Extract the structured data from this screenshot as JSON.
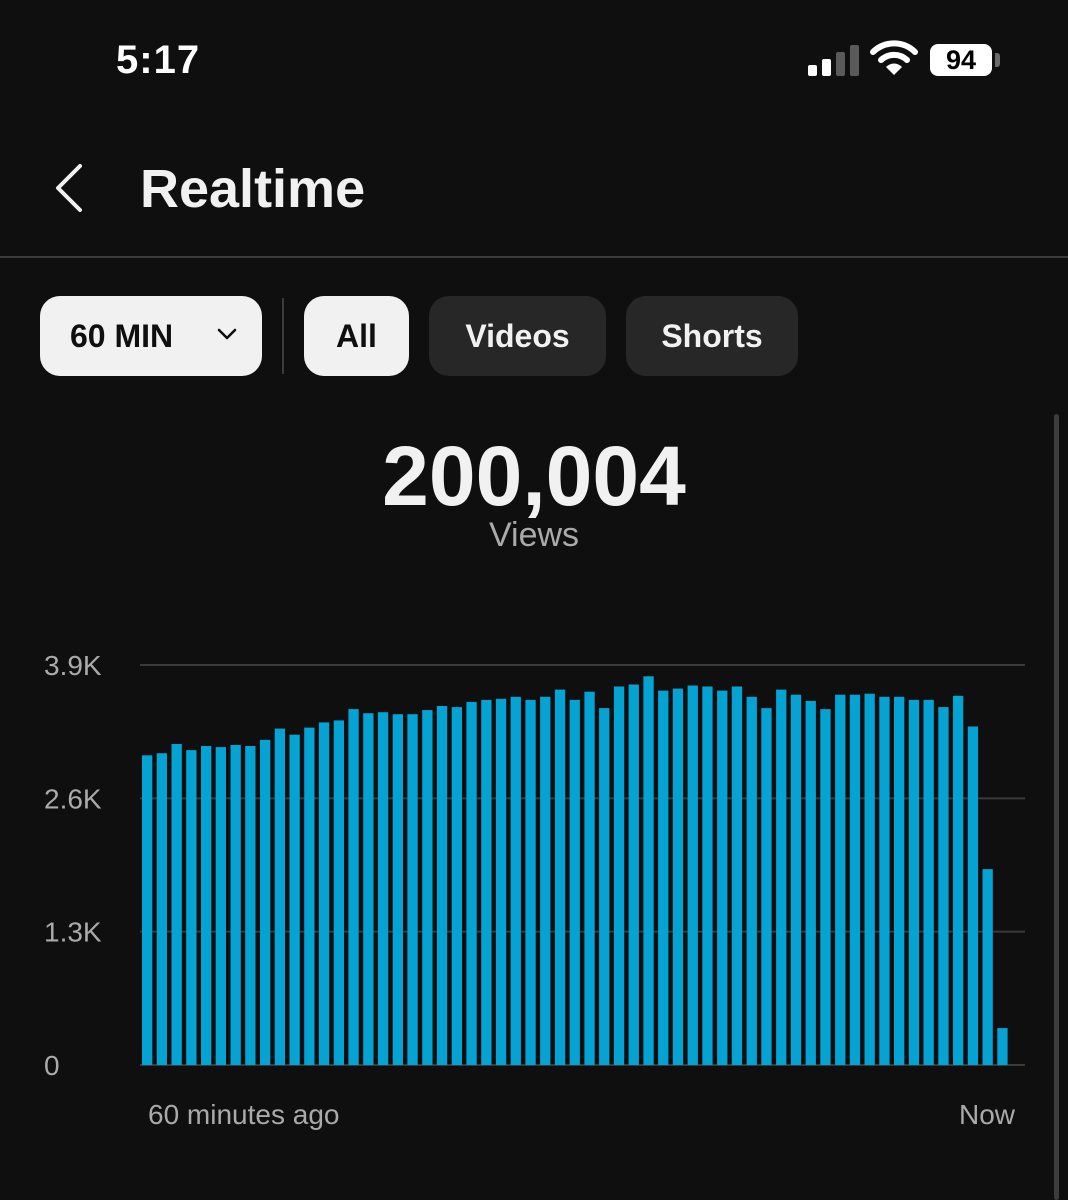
{
  "status_bar": {
    "time": "5:17",
    "battery": "94",
    "signal_icon": "cellular-signal-icon",
    "wifi_icon": "wifi-icon",
    "battery_icon": "battery-icon"
  },
  "header": {
    "back_icon": "chevron-left-icon",
    "title": "Realtime"
  },
  "filters": {
    "period": "60 MIN",
    "chips": [
      "All",
      "Videos",
      "Shorts"
    ],
    "selected": "All"
  },
  "metric": {
    "value": "200,004",
    "label": "Views"
  },
  "colors": {
    "bar": "#04a3d3",
    "background": "#0f0f0f",
    "chip_selected": "#f1f1f1",
    "chip_unselected": "#272727"
  },
  "chart_data": {
    "type": "bar",
    "y_ticks": [
      "3.9K",
      "2.6K",
      "1.3K",
      "0"
    ],
    "ylim": [
      0,
      3900
    ],
    "x_start_label": "60 minutes ago",
    "x_end_label": "Now",
    "grid": true,
    "values": [
      3020,
      3040,
      3130,
      3070,
      3110,
      3100,
      3120,
      3110,
      3170,
      3280,
      3220,
      3290,
      3340,
      3360,
      3470,
      3430,
      3440,
      3420,
      3420,
      3460,
      3500,
      3490,
      3540,
      3560,
      3570,
      3590,
      3560,
      3590,
      3660,
      3560,
      3640,
      3480,
      3690,
      3710,
      3790,
      3650,
      3670,
      3700,
      3690,
      3650,
      3690,
      3590,
      3480,
      3660,
      3610,
      3550,
      3470,
      3610,
      3610,
      3620,
      3590,
      3590,
      3560,
      3560,
      3490,
      3600,
      3300,
      1910,
      360
    ]
  }
}
